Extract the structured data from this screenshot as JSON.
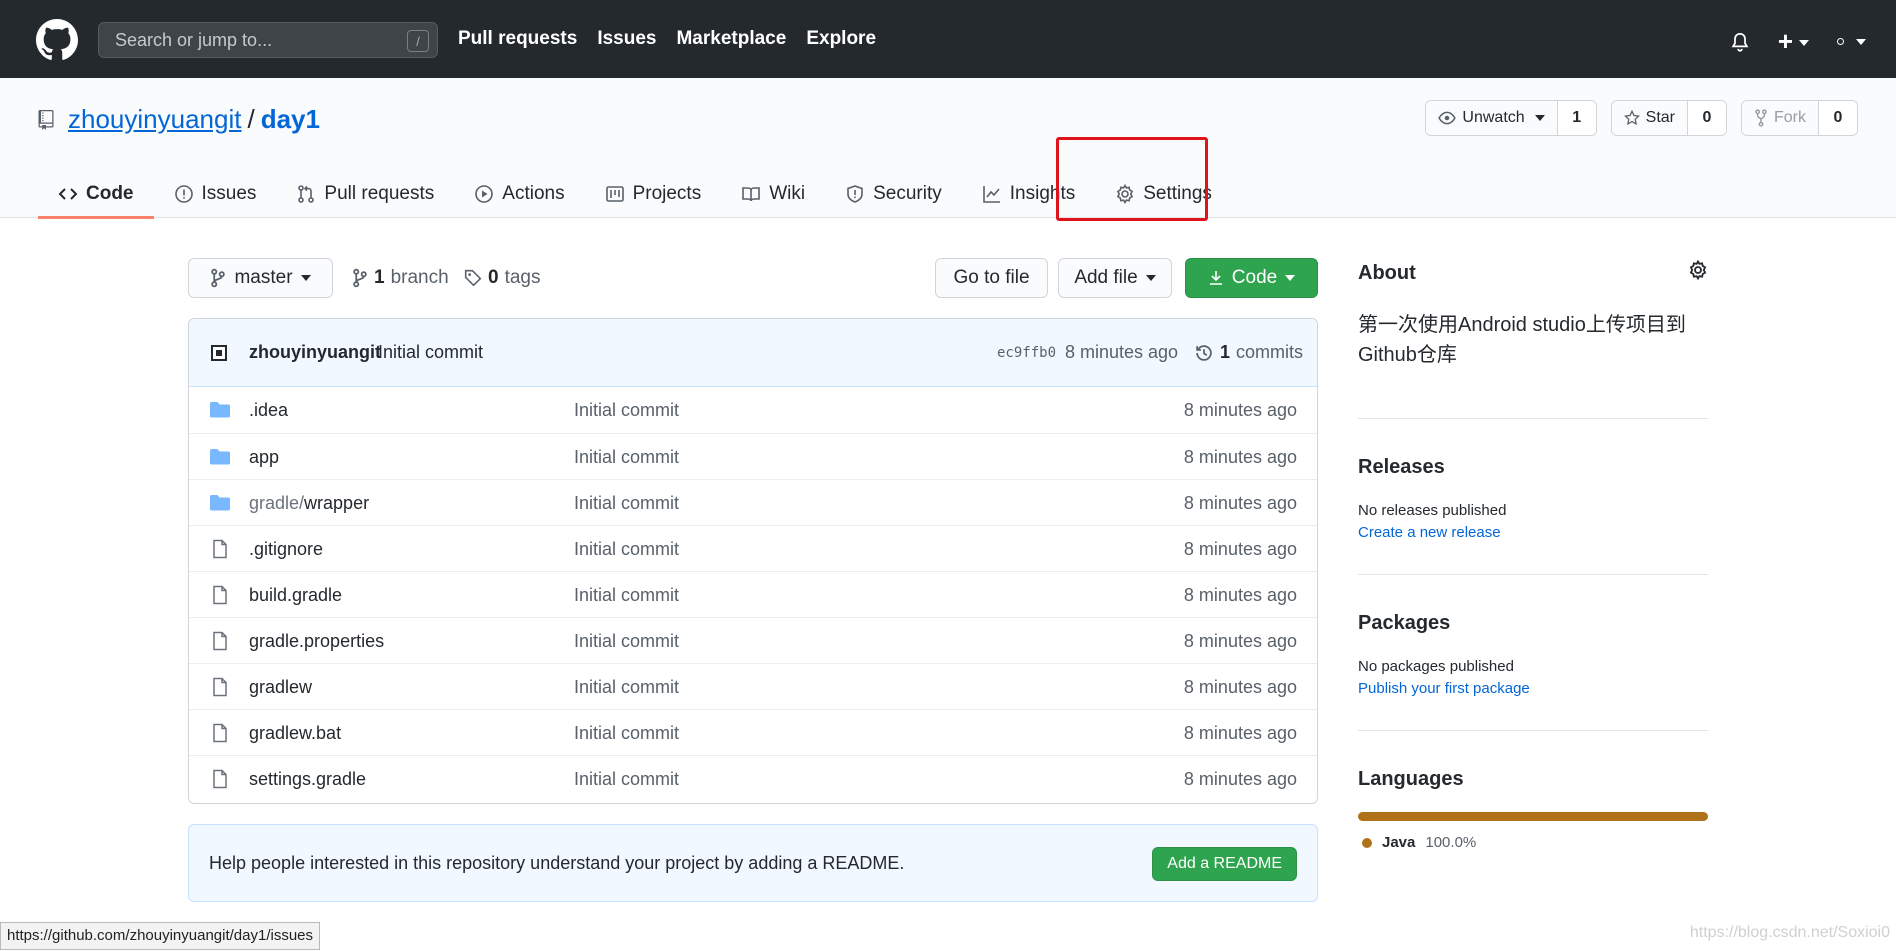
{
  "header": {
    "search_placeholder": "Search or jump to...",
    "search_shortcut": "/",
    "nav": [
      "Pull requests",
      "Issues",
      "Marketplace",
      "Explore"
    ],
    "plus": "+"
  },
  "repo": {
    "owner": "zhouyinyuangit",
    "separator": "/",
    "name": "day1",
    "watch_label": "Unwatch",
    "watch_count": "1",
    "star_label": "Star",
    "star_count": "0",
    "fork_label": "Fork",
    "fork_count": "0"
  },
  "tabs": [
    {
      "label": "Code",
      "icon": "code-icon"
    },
    {
      "label": "Issues",
      "icon": "issue-icon"
    },
    {
      "label": "Pull requests",
      "icon": "pull-request-icon"
    },
    {
      "label": "Actions",
      "icon": "play-icon"
    },
    {
      "label": "Projects",
      "icon": "project-icon"
    },
    {
      "label": "Wiki",
      "icon": "book-icon"
    },
    {
      "label": "Security",
      "icon": "shield-icon"
    },
    {
      "label": "Insights",
      "icon": "graph-icon"
    },
    {
      "label": "Settings",
      "icon": "gear-icon"
    }
  ],
  "branchbar": {
    "branch": "master",
    "branch_count": "1",
    "branch_word": "branch",
    "tag_count": "0",
    "tag_word": "tags",
    "goto_file": "Go to file",
    "add_file": "Add file",
    "code": "Code"
  },
  "latest_commit": {
    "author": "zhouyinyuangit",
    "message": "Initial commit",
    "sha": "ec9ffb0",
    "ago": "8 minutes ago",
    "commit_count": "1",
    "commit_word": "commits"
  },
  "files": [
    {
      "type": "dir",
      "name": ".idea",
      "prefix": "",
      "message": "Initial commit",
      "age": "8 minutes ago"
    },
    {
      "type": "dir",
      "name": "app",
      "prefix": "",
      "message": "Initial commit",
      "age": "8 minutes ago"
    },
    {
      "type": "dir",
      "name": "wrapper",
      "prefix": "gradle/",
      "message": "Initial commit",
      "age": "8 minutes ago"
    },
    {
      "type": "file",
      "name": ".gitignore",
      "prefix": "",
      "message": "Initial commit",
      "age": "8 minutes ago"
    },
    {
      "type": "file",
      "name": "build.gradle",
      "prefix": "",
      "message": "Initial commit",
      "age": "8 minutes ago"
    },
    {
      "type": "file",
      "name": "gradle.properties",
      "prefix": "",
      "message": "Initial commit",
      "age": "8 minutes ago"
    },
    {
      "type": "file",
      "name": "gradlew",
      "prefix": "",
      "message": "Initial commit",
      "age": "8 minutes ago"
    },
    {
      "type": "file",
      "name": "gradlew.bat",
      "prefix": "",
      "message": "Initial commit",
      "age": "8 minutes ago"
    },
    {
      "type": "file",
      "name": "settings.gradle",
      "prefix": "",
      "message": "Initial commit",
      "age": "8 minutes ago"
    }
  ],
  "readme": {
    "text": "Help people interested in this repository understand your project by adding a README.",
    "button": "Add a README"
  },
  "sidebar": {
    "about_title": "About",
    "about_desc": "第一次使用Android studio上传项目到Github仓库",
    "releases_title": "Releases",
    "releases_none": "No releases published",
    "releases_link": "Create a new release",
    "packages_title": "Packages",
    "packages_none": "No packages published",
    "packages_link": "Publish your first package",
    "languages_title": "Languages",
    "language_name": "Java",
    "language_pct": "100.0%",
    "language_share": 1.0
  },
  "statusbar": "https://github.com/zhouyinyuangit/day1/issues",
  "watermark": "https://blog.csdn.net/Soxioi0",
  "colors": {
    "header_bg": "#24292e",
    "link": "#0366d6",
    "green_button": "#2ea44f",
    "active_tab_underline": "#f9826c",
    "highlight_box": "#e0131a",
    "java": "#b07219"
  }
}
